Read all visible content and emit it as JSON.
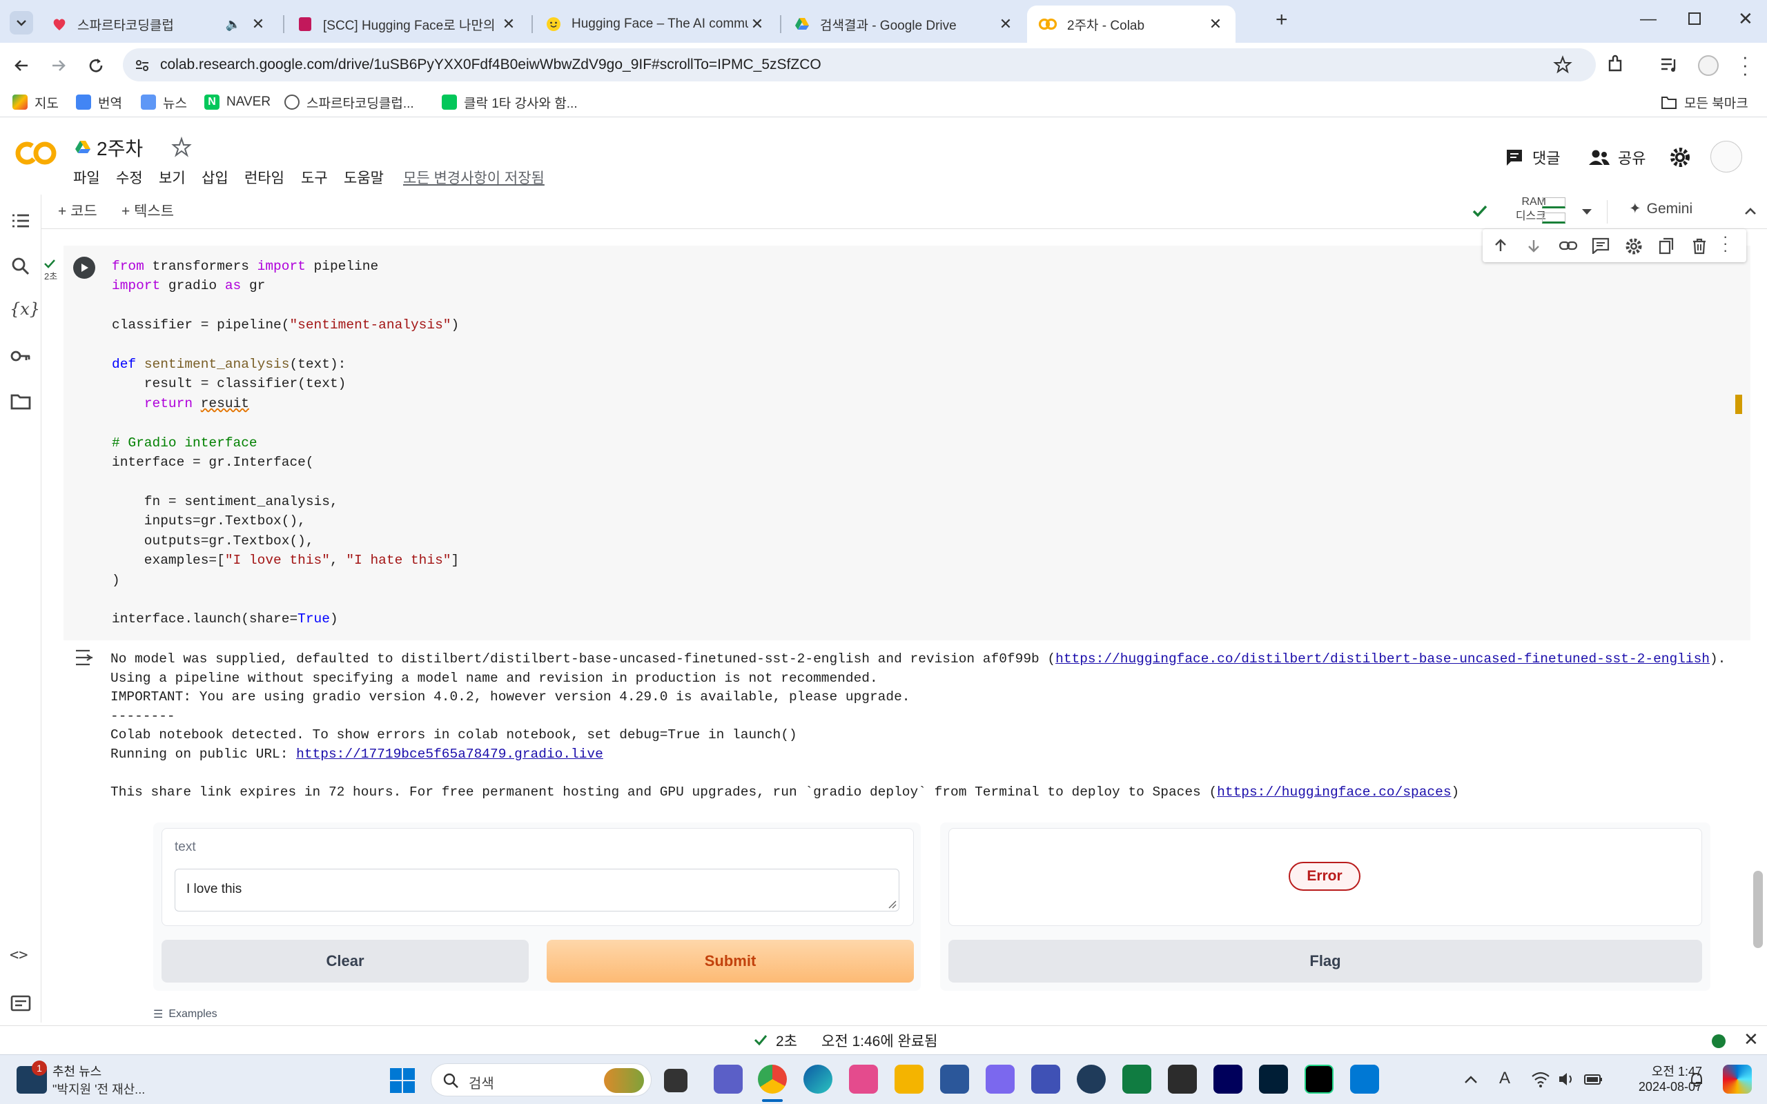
{
  "browser": {
    "tabs": [
      {
        "title": "스파르타코딩클럽",
        "icon": "heart-icon"
      },
      {
        "title": "[SCC] Hugging Face로 나만의",
        "icon": "notebook-icon"
      },
      {
        "title": "Hugging Face – The AI commu",
        "icon": "hugging-face-icon"
      },
      {
        "title": "검색결과 - Google Drive",
        "icon": "google-drive-icon"
      },
      {
        "title": "2주차 - Colab",
        "icon": "colab-icon"
      }
    ],
    "new_tab": "+",
    "url": "colab.research.google.com/drive/1uSB6PyYXX0Fdf4B0eiwWbwZdV9go_9IF#scrollTo=IPMC_5zSfZCO",
    "bookmarks": [
      "지도",
      "번역",
      "뉴스",
      "NAVER",
      "스파르타코딩클럽...",
      "클락 1타 강사와 함..."
    ],
    "all_bookmarks": "모든 북마크"
  },
  "colab": {
    "logo": "CO",
    "notebook_title": "2주차",
    "menu": [
      "파일",
      "수정",
      "보기",
      "삽입",
      "런타임",
      "도구",
      "도움말"
    ],
    "save_status": "모든 변경사항이 저장됨",
    "comment_label": "댓글",
    "share_label": "공유",
    "add_code": "+ 코드",
    "add_text": "+ 텍스트",
    "ram_label": "RAM",
    "disk_label": "디스크",
    "gemini_label": "Gemini",
    "exec_time": "2초",
    "code_lines": [
      "from transformers import pipeline",
      "import gradio as gr",
      "",
      "classifier = pipeline(\"sentiment-analysis\")",
      "",
      "def sentiment_analysis(text):",
      "    result = classifier(text)",
      "    return resuit",
      "",
      "# Gradio interface",
      "interface = gr.Interface(",
      "",
      "    fn = sentiment_analysis,",
      "    inputs=gr.Textbox(),",
      "    outputs=gr.Textbox(),",
      "    examples=[\"I love this\", \"I hate this\"]",
      ")",
      "",
      "interface.launch(share=True)"
    ],
    "output": {
      "line1_text": "No model was supplied, defaulted to distilbert/distilbert-base-uncased-finetuned-sst-2-english and revision af0f99b (",
      "line1_link": "https://huggingface.co/distilbert/distilbert-base-uncased-finetuned-sst-2-english",
      "line1_end": ").",
      "line2": "Using a pipeline without specifying a model name and revision in production is not recommended.",
      "line3": "IMPORTANT: You are using gradio version 4.0.2, however version 4.29.0 is available, please upgrade.",
      "line4": "--------",
      "line5": "Colab notebook detected. To show errors in colab notebook, set debug=True in launch()",
      "line6_text": "Running on public URL: ",
      "line6_link": "https://17719bce5f65a78479.gradio.live",
      "line7_text": "This share link expires in 72 hours. For free permanent hosting and GPU upgrades, run `gradio deploy` from Terminal to deploy to Spaces (",
      "line7_link": "https://huggingface.co/spaces",
      "line7_end": ")"
    },
    "gradio": {
      "input_label": "text",
      "input_value": "I love this",
      "error_label": "Error",
      "clear": "Clear",
      "submit": "Submit",
      "flag": "Flag",
      "examples": "Examples"
    },
    "status": {
      "time": "2초",
      "completed": "오전 1:46에 완료됨"
    }
  },
  "taskbar": {
    "news_title": "추천 뉴스",
    "news_sub": "\"박지원 '전 재산...",
    "news_badge": "1",
    "search_placeholder": "검색",
    "clock_time": "오전 1:47",
    "clock_date": "2024-08-07"
  },
  "colors": {
    "accent_orange": "#f9ab00",
    "submit_bg": "#fdba74",
    "error_red": "#b91c1c",
    "check_green": "#188038",
    "link_blue": "#1a0dab"
  }
}
